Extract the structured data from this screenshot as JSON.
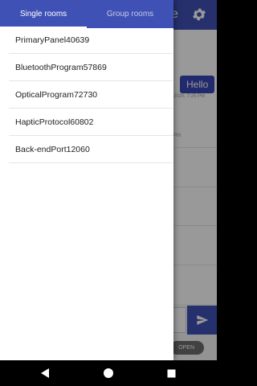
{
  "drawer": {
    "tabs": [
      {
        "label": "Single rooms",
        "selected": true
      },
      {
        "label": "Group rooms",
        "selected": false
      }
    ],
    "rooms": [
      {
        "name": "PrimaryPanel40639"
      },
      {
        "name": "BluetoothProgram57869"
      },
      {
        "name": "OpticalProgram72730"
      },
      {
        "name": "HapticProtocol60802"
      },
      {
        "name": "Back-endPort12060"
      }
    ]
  },
  "background": {
    "title_fragment": "e",
    "message_text": "Hello",
    "timestamp_1": "2020, 7:25 PM",
    "timestamp_2": "PM",
    "open_button_label": "OPEN",
    "icons": [
      "gear-icon",
      "send-icon"
    ]
  },
  "colors": {
    "primary": "#3f51b5",
    "bubble": "#3947b8"
  }
}
